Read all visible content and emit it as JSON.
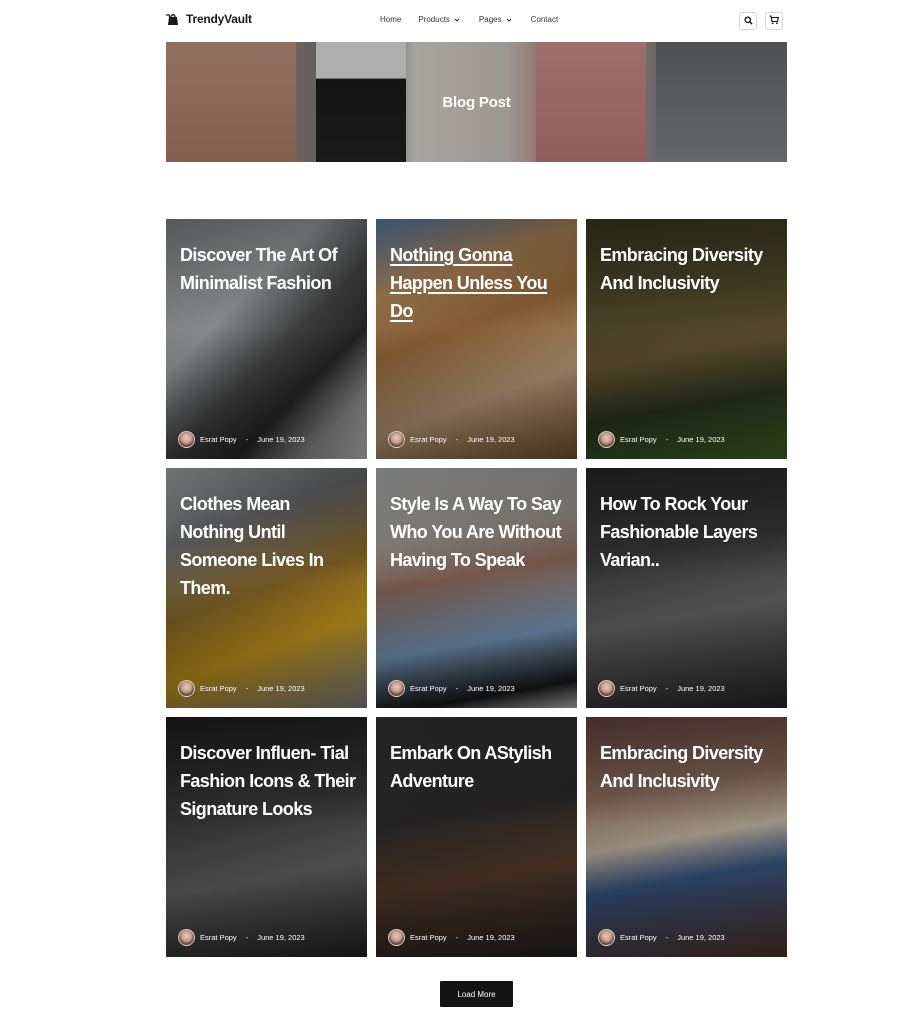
{
  "nav": {
    "brand": "TrendyVault",
    "menu": [
      {
        "label": "Home"
      },
      {
        "label": "Products"
      },
      {
        "label": "Pages"
      },
      {
        "label": "Contact"
      }
    ],
    "icons": {
      "search": "search-icon",
      "cart": "cart-icon",
      "logo": "shopping-bag-icon"
    }
  },
  "hero": {
    "title": "Blog Post"
  },
  "posts": [
    {
      "title": "Discover The Art Of Minimalist Fashion",
      "author": "Esrat Popy",
      "date": "June 19, 2023"
    },
    {
      "title": "Nothing Gonna Happen Unless You Do",
      "author": "Esrat Popy",
      "date": "June 19, 2023"
    },
    {
      "title": "Embracing Diversity And Inclusivity",
      "author": "Esrat Popy",
      "date": "June 19, 2023"
    },
    {
      "title": "Clothes Mean Nothing Until Someone Lives In Them.",
      "author": "Esrat Popy",
      "date": "June 19, 2023"
    },
    {
      "title": "Style Is A Way To Say Who You Are Without Having To Speak",
      "author": "Esrat Popy",
      "date": "June 19, 2023"
    },
    {
      "title": "How To Rock Your Fashionable Layers Varian..",
      "author": "Esrat Popy",
      "date": "June 19, 2023"
    },
    {
      "title": "Discover Influen- Tial Fashion Icons & Their Signature Looks",
      "author": "Esrat Popy",
      "date": "June 19, 2023"
    },
    {
      "title": "Embark On AStylish Adventure",
      "author": "Esrat Popy",
      "date": "June 19, 2023"
    },
    {
      "title": "Embracing Diversity And Inclusivity",
      "author": "Esrat Popy",
      "date": "June 19, 2023"
    }
  ],
  "load_more": {
    "label": "Load More"
  },
  "colors": {
    "text": "#1a1a1a",
    "button_bg": "#141414",
    "button_text": "#ffffff",
    "card_text": "#ffffff"
  }
}
